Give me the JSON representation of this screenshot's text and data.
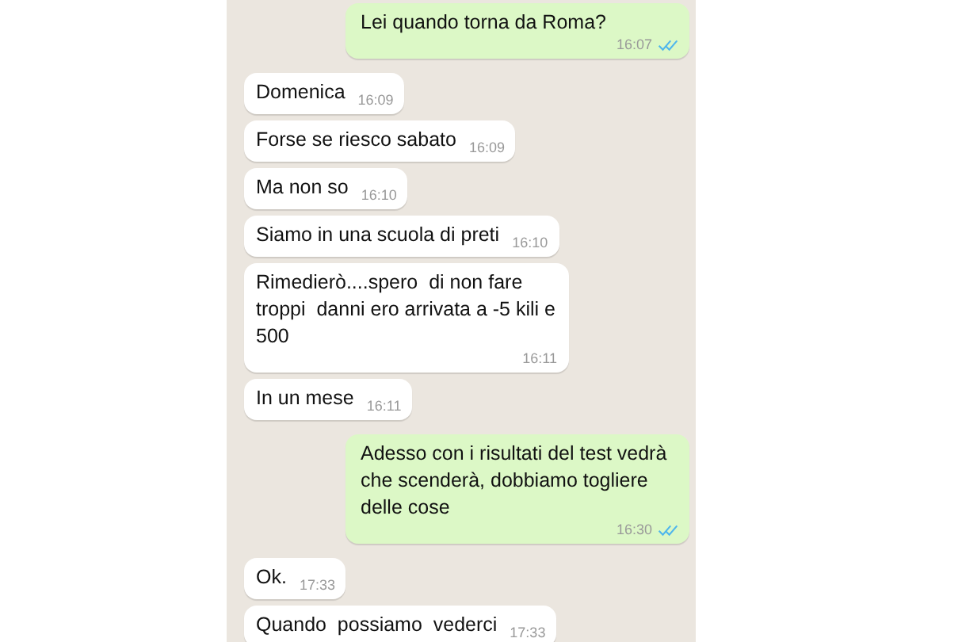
{
  "messages": [
    {
      "kind": "outgoing",
      "text": "Lei quando torna da Roma?",
      "time": "16:07",
      "read": true
    },
    {
      "kind": "incoming",
      "text": "Domenica",
      "time": "16:09"
    },
    {
      "kind": "incoming",
      "text": "Forse se riesco sabato",
      "time": "16:09"
    },
    {
      "kind": "incoming",
      "text": "Ma non so",
      "time": "16:10"
    },
    {
      "kind": "incoming",
      "text": "Siamo in una scuola di preti",
      "time": "16:10"
    },
    {
      "kind": "incoming",
      "text": "Rimedierò....spero  di non fare troppi  danni ero arrivata a -5 kili e 500",
      "time": "16:11"
    },
    {
      "kind": "incoming",
      "text": "In un mese",
      "time": "16:11"
    },
    {
      "kind": "outgoing",
      "text": "Adesso con i risultati del test vedrà che scenderà, dobbiamo togliere delle cose",
      "time": "16:30",
      "read": true
    },
    {
      "kind": "incoming",
      "text": "Ok.",
      "time": "17:33"
    },
    {
      "kind": "incoming",
      "text": "Quando  possiamo  vederci",
      "time": "17:33"
    }
  ]
}
